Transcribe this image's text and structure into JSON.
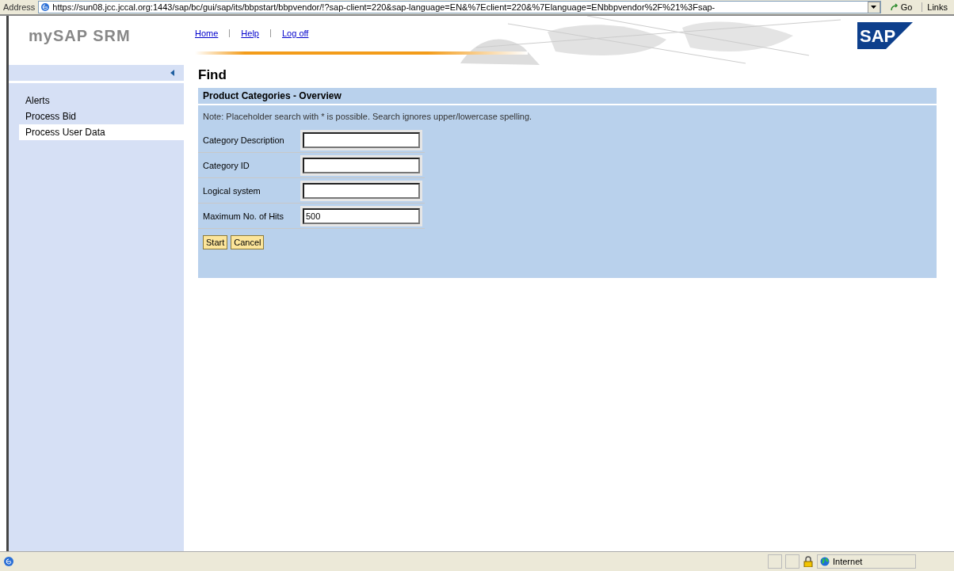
{
  "address_bar": {
    "label": "Address",
    "url": "https://sun08.jcc.jccal.org:1443/sap/bc/gui/sap/its/bbpstart/bbpvendor/!?sap-client=220&sap-language=EN&%7Eclient=220&%7Elanguage=ENbbpvendor%2F%21%3Fsap-",
    "go": "Go",
    "links": "Links"
  },
  "header": {
    "title": "mySAP SRM",
    "nav": [
      "Home",
      "Help",
      "Log off"
    ],
    "logo": "SAP"
  },
  "sidebar": {
    "items": [
      {
        "label": "Alerts",
        "selected": false
      },
      {
        "label": "Process Bid",
        "selected": false
      },
      {
        "label": "Process User Data",
        "selected": true
      }
    ]
  },
  "page_title": "Find",
  "panel": {
    "title": "Product Categories - Overview",
    "note": "Note: Placeholder search with * is possible. Search ignores upper/lowercase spelling.",
    "fields": [
      {
        "label": "Category Description"
      },
      {
        "label": "Category ID"
      },
      {
        "label": "Logical system"
      },
      {
        "label": "Maximum No. of Hits",
        "value": "500"
      }
    ],
    "buttons": [
      "Start",
      "Cancel"
    ]
  },
  "status_bar": {
    "zone": "Internet"
  }
}
